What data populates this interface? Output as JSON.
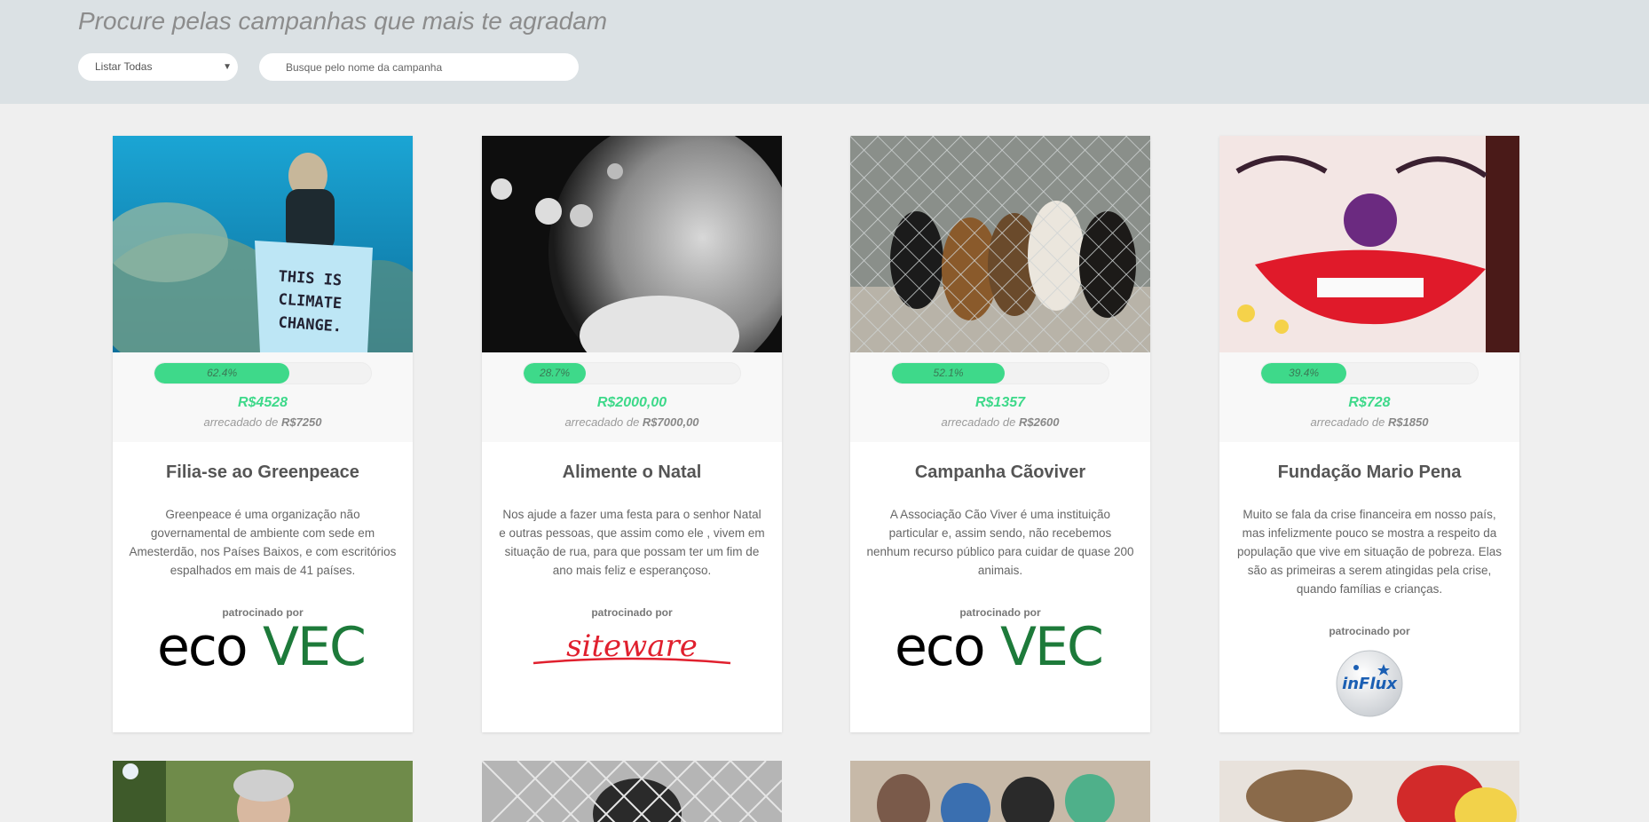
{
  "header": {
    "title": "Procure pelas campanhas que mais te agradam",
    "filter": {
      "selected": "Listar Todas"
    },
    "search": {
      "placeholder": "Busque pelo nome da campanha"
    }
  },
  "colors": {
    "accent": "#3ed98a",
    "header_bg": "#dbe1e4",
    "page_bg": "#efefef"
  },
  "campaigns": [
    {
      "title": "Filia-se ao Greenpeace",
      "description": "Greenpeace é uma organização não governamental de ambiente com sede em Amesterdão, nos Países Baixos, e com escritórios espalhados em mais de 41 países.",
      "progress": 62.4,
      "progress_label": "62.4%",
      "raised": "R$4528",
      "goal_prefix": "arrecadado de",
      "goal": "R$7250",
      "image_sign_text": [
        "THIS IS",
        "CLIMATE",
        "CHANGE."
      ],
      "sponsor_label": "patrocinado por",
      "sponsor": "ecovec"
    },
    {
      "title": "Alimente o Natal",
      "description": "Nos ajude a fazer uma festa para o senhor Natal e outras pessoas, que assim como ele , vivem em situação de rua, para que possam ter um fim de ano mais feliz e esperançoso.",
      "progress": 28.7,
      "progress_label": "28.7%",
      "raised": "R$2000,00",
      "goal_prefix": "arrecadado de",
      "goal": "R$7000,00",
      "sponsor_label": "patrocinado por",
      "sponsor": "siteware"
    },
    {
      "title": "Campanha Cãoviver",
      "description": "A Associação Cão Viver é uma instituição particular e, assim sendo, não recebemos nenhum recurso público para cuidar de quase 200 animais.",
      "progress": 52.1,
      "progress_label": "52.1%",
      "raised": "R$1357",
      "goal_prefix": "arrecadado de",
      "goal": "R$2600",
      "sponsor_label": "patrocinado por",
      "sponsor": "ecovec"
    },
    {
      "title": "Fundação Mario Pena",
      "description": "Muito se fala da crise financeira em nosso país, mas infelizmente pouco se mostra a respeito da população que vive em situação de pobreza. Elas são as primeiras a serem atingidas pela crise, quando famílias e crianças.",
      "progress": 39.4,
      "progress_label": "39.4%",
      "raised": "R$728",
      "goal_prefix": "arrecadado de",
      "goal": "R$1850",
      "sponsor_label": "patrocinado por",
      "sponsor": "inFlux"
    }
  ]
}
